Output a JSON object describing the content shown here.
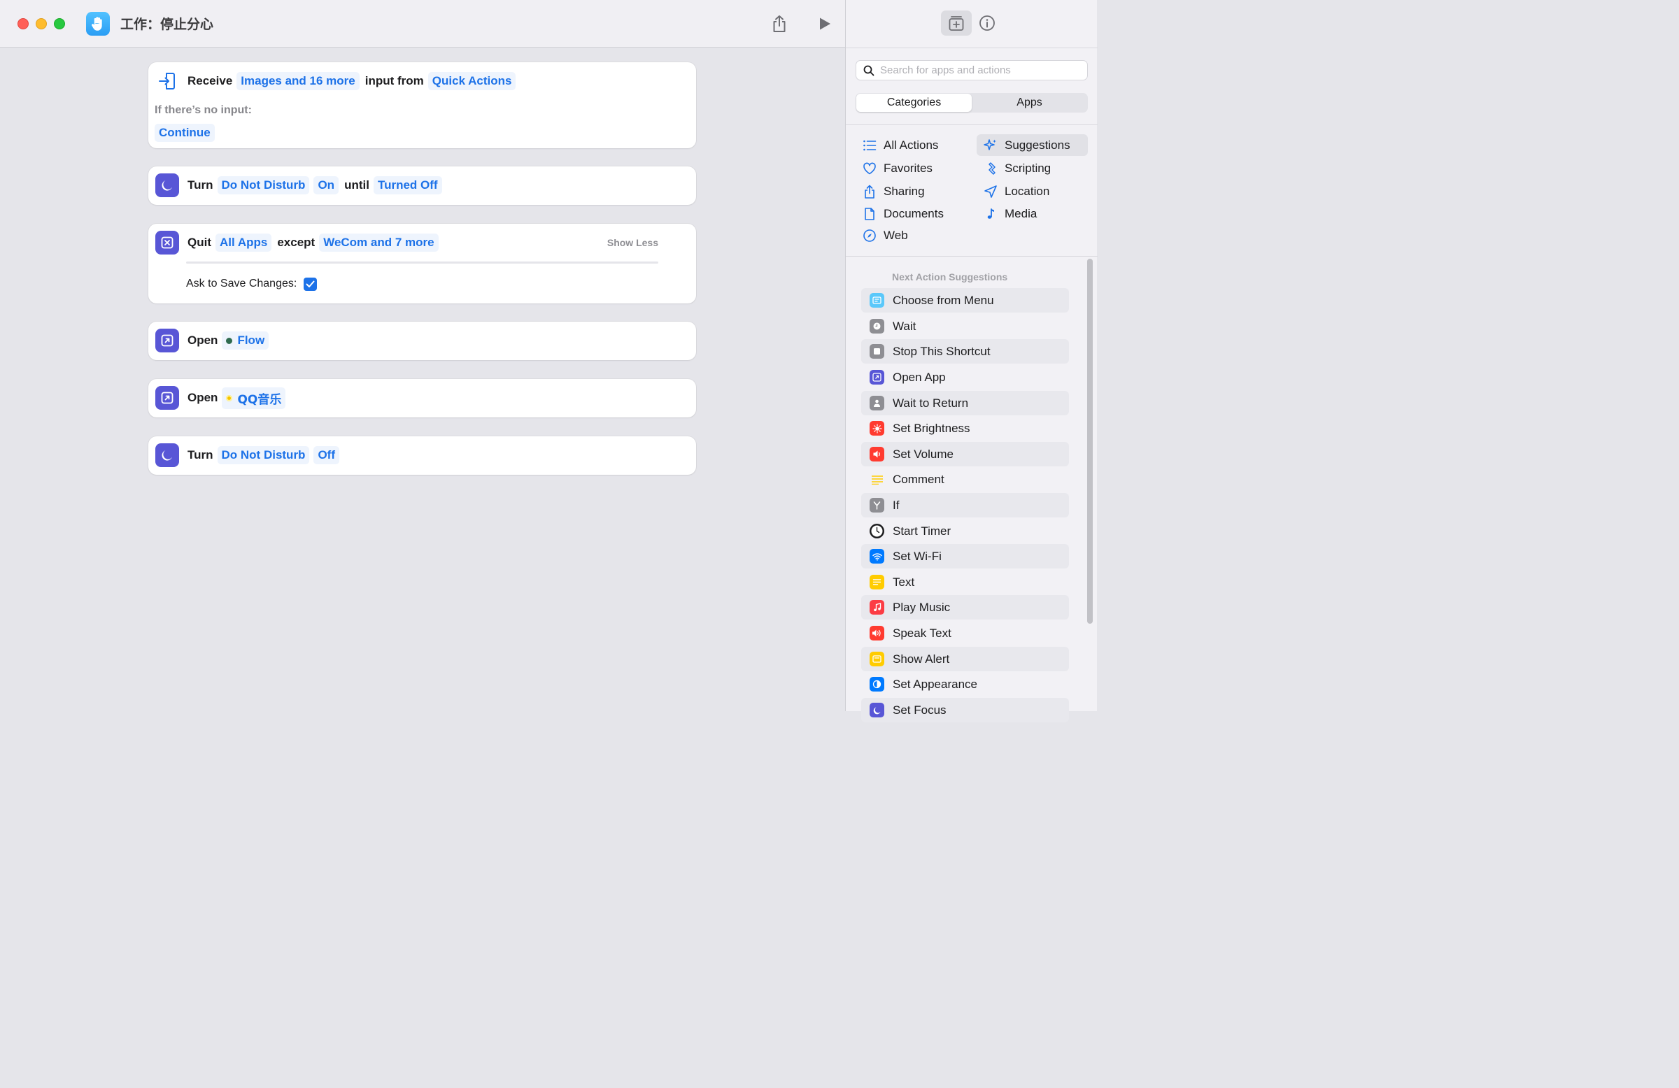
{
  "window": {
    "title": "工作：停止分心"
  },
  "actions": {
    "receive": {
      "verb": "Receive",
      "types_token": "Images and 16 more",
      "middle": "input from",
      "source_token": "Quick Actions",
      "no_input_label": "If there’s no input:",
      "no_input_token": "Continue"
    },
    "turn_on": {
      "verb": "Turn",
      "target": "Do Not Disturb",
      "state": "On",
      "middle": "until",
      "until": "Turned Off"
    },
    "quit": {
      "verb": "Quit",
      "target": "All Apps",
      "middle": "except",
      "except": "WeCom and 7 more",
      "toggle": "Show Less",
      "ask_label": "Ask to Save Changes:",
      "ask_checked": true
    },
    "open_flow": {
      "verb": "Open",
      "app": "Flow",
      "app_dot_color": "#2f6b4f"
    },
    "open_qq": {
      "verb": "Open",
      "app": "QQ音乐",
      "app_dot_color": "#f5c400"
    },
    "turn_off": {
      "verb": "Turn",
      "target": "Do Not Disturb",
      "state": "Off"
    }
  },
  "sidebar": {
    "search_placeholder": "Search for apps and actions",
    "tabs": [
      "Categories",
      "Apps"
    ],
    "active_tab": "Categories",
    "categories_left": [
      {
        "label": "All Actions",
        "icon": "list-icon"
      },
      {
        "label": "Favorites",
        "icon": "heart-icon"
      },
      {
        "label": "Sharing",
        "icon": "share-icon"
      },
      {
        "label": "Documents",
        "icon": "document-icon"
      },
      {
        "label": "Web",
        "icon": "compass-icon"
      }
    ],
    "categories_right": [
      {
        "label": "Suggestions",
        "icon": "sparkle-icon"
      },
      {
        "label": "Scripting",
        "icon": "scripting-icon"
      },
      {
        "label": "Location",
        "icon": "location-arrow-icon"
      },
      {
        "label": "Media",
        "icon": "music-note-icon"
      }
    ],
    "selected_category": "Suggestions",
    "suggestions_header": "Next Action Suggestions",
    "suggestions": [
      {
        "label": "Choose from Menu",
        "icon": "menu-icon",
        "color": "#5ac8fa"
      },
      {
        "label": "Wait",
        "icon": "clock-icon",
        "color": "#8e8e93"
      },
      {
        "label": "Stop This Shortcut",
        "icon": "stop-icon",
        "color": "#8e8e93"
      },
      {
        "label": "Open App",
        "icon": "open-app-icon",
        "color": "#5856d6"
      },
      {
        "label": "Wait to Return",
        "icon": "wait-return-icon",
        "color": "#8e8e93"
      },
      {
        "label": "Set Brightness",
        "icon": "sun-icon",
        "color": "#ff3b30"
      },
      {
        "label": "Set Volume",
        "icon": "speaker-icon",
        "color": "#ff3b30"
      },
      {
        "label": "Comment",
        "icon": "comment-lines-icon",
        "color": "#ffcc00"
      },
      {
        "label": "If",
        "icon": "branch-icon",
        "color": "#8e8e93"
      },
      {
        "label": "Start Timer",
        "icon": "clock-app-icon",
        "color": "#1d1d1f"
      },
      {
        "label": "Set Wi-Fi",
        "icon": "wifi-icon",
        "color": "#007aff"
      },
      {
        "label": "Text",
        "icon": "text-icon",
        "color": "#ffcc00"
      },
      {
        "label": "Play Music",
        "icon": "music-icon",
        "color": "#fc3c44"
      },
      {
        "label": "Speak Text",
        "icon": "speak-icon",
        "color": "#ff3b30"
      },
      {
        "label": "Show Alert",
        "icon": "alert-icon",
        "color": "#ffcc00"
      },
      {
        "label": "Set Appearance",
        "icon": "appearance-icon",
        "color": "#007aff"
      },
      {
        "label": "Set Focus",
        "icon": "moon-icon",
        "color": "#5856d6"
      }
    ]
  }
}
